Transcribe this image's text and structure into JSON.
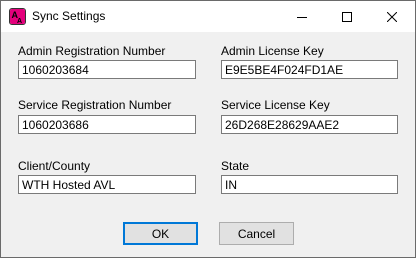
{
  "window": {
    "title": "Sync Settings",
    "icon": "app-logo-icon",
    "accent_color": "#e4007c"
  },
  "titlebar_controls": {
    "minimize_icon": "minimize-icon",
    "maximize_icon": "maximize-icon",
    "close_icon": "close-icon"
  },
  "fields": {
    "admin_registration_number": {
      "label": "Admin Registration Number",
      "value": "1060203684"
    },
    "admin_license_key": {
      "label": "Admin License Key",
      "value": "E9E5BE4F024FD1AE"
    },
    "service_registration_number": {
      "label": "Service Registration Number",
      "value": "1060203686"
    },
    "service_license_key": {
      "label": "Service License Key",
      "value": "26D268E28629AAE2"
    },
    "client_county": {
      "label": "Client/County",
      "value": "WTH Hosted AVL"
    },
    "state": {
      "label": "State",
      "value": "IN"
    }
  },
  "buttons": {
    "ok_label": "OK",
    "cancel_label": "Cancel"
  }
}
